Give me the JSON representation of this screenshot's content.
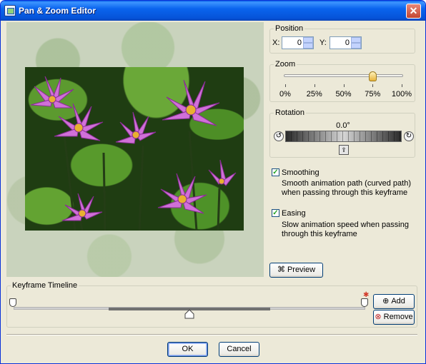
{
  "window": {
    "title": "Pan & Zoom Editor",
    "close_glyph": "✕"
  },
  "position": {
    "label": "Position",
    "x_label": "X:",
    "x_value": "0",
    "y_label": "Y:",
    "y_value": "0"
  },
  "zoom": {
    "label": "Zoom",
    "value_percent": 75,
    "ticks": [
      "0%",
      "25%",
      "50%",
      "75%",
      "100%"
    ]
  },
  "rotation": {
    "label": "Rotation",
    "value": "0.0°"
  },
  "smoothing": {
    "label": "Smoothing",
    "checked": true,
    "description_line1": "Smooth animation path (curved path)",
    "description_line2": "when passing through this keyframe"
  },
  "easing": {
    "label": "Easing",
    "checked": true,
    "description_line1": "Slow animation speed when passing",
    "description_line2": "through this keyframe"
  },
  "preview_button": "Preview",
  "timeline": {
    "label": "Keyframe Timeline",
    "add_label": "Add",
    "remove_label": "Remove"
  },
  "footer": {
    "ok_label": "OK",
    "cancel_label": "Cancel"
  },
  "icons": [
    "app-icon",
    "close-icon",
    "rotate-ccw-icon",
    "rotate-cw-icon",
    "reset-rotation-icon",
    "binoculars-icon",
    "add-keyframe-icon",
    "remove-keyframe-icon"
  ]
}
